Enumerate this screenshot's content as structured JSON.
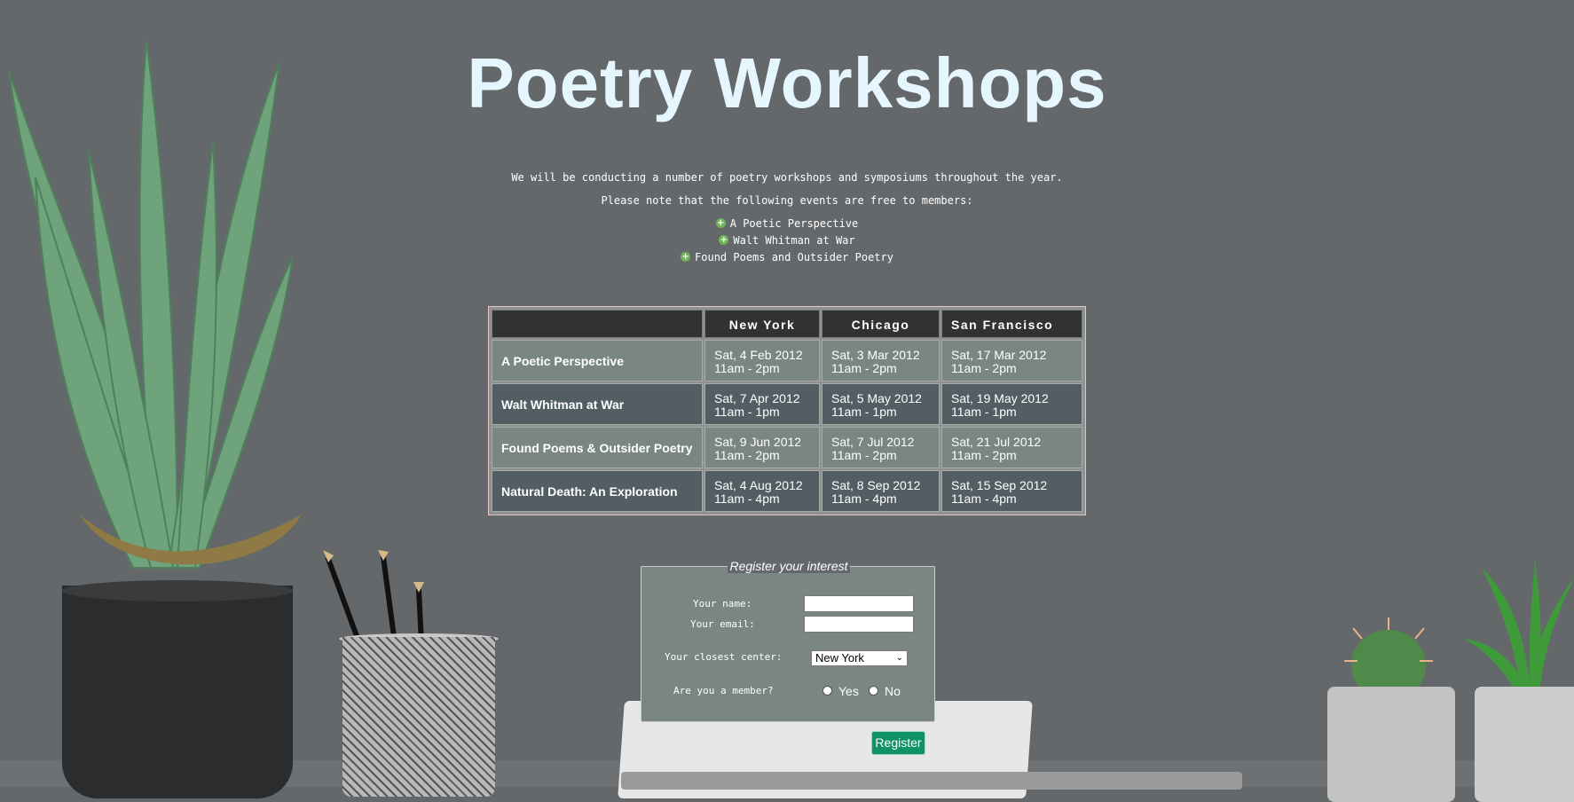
{
  "page": {
    "title": "Poetry Workshops",
    "intro_line1": "We will be conducting a number of poetry workshops and symposiums throughout the year.",
    "intro_line2": "Please note that the following events are free to members:",
    "free_events": [
      "A Poetic Perspective",
      "Walt Whitman at War",
      "Found Poems and Outsider Poetry"
    ]
  },
  "schedule": {
    "columns": [
      "",
      "New York",
      "Chicago",
      "San Francisco"
    ],
    "rows": [
      {
        "event": "A Poetic Perspective",
        "cells": [
          {
            "date": "Sat, 4 Feb 2012",
            "time": "11am - 2pm"
          },
          {
            "date": "Sat, 3 Mar 2012",
            "time": "11am - 2pm"
          },
          {
            "date": "Sat, 17 Mar 2012",
            "time": "11am - 2pm"
          }
        ]
      },
      {
        "event": "Walt Whitman at War",
        "cells": [
          {
            "date": "Sat, 7 Apr 2012",
            "time": "11am - 1pm"
          },
          {
            "date": "Sat, 5 May 2012",
            "time": "11am - 1pm"
          },
          {
            "date": "Sat, 19 May 2012",
            "time": "11am - 1pm"
          }
        ]
      },
      {
        "event": "Found Poems & Outsider Poetry",
        "cells": [
          {
            "date": "Sat, 9 Jun 2012",
            "time": "11am - 2pm"
          },
          {
            "date": "Sat, 7 Jul 2012",
            "time": "11am - 2pm"
          },
          {
            "date": "Sat, 21 Jul 2012",
            "time": "11am - 2pm"
          }
        ]
      },
      {
        "event": "Natural Death: An Exploration",
        "cells": [
          {
            "date": "Sat, 4 Aug 2012",
            "time": "11am - 4pm"
          },
          {
            "date": "Sat, 8 Sep 2012",
            "time": "11am - 4pm"
          },
          {
            "date": "Sat, 15 Sep 2012",
            "time": "11am - 4pm"
          }
        ]
      }
    ]
  },
  "form": {
    "legend": "Register your interest",
    "name_label": "Your name:",
    "name_value": "",
    "email_label": "Your email:",
    "email_value": "",
    "center_label": "Your closest center:",
    "center_selected": "New York",
    "member_label": "Are you a member?",
    "yes_label": "Yes",
    "no_label": "No",
    "submit_label": "Register"
  },
  "icons": {
    "bullet": "plus-circle-icon",
    "select_arrow": "chevron-down-icon"
  },
  "colors": {
    "background": "#65686b",
    "title": "#e6f6ff",
    "header_cell": "#303234",
    "row_light": "#7a8684",
    "row_dark": "#525e63",
    "bullet": "#6db556",
    "button": "#0f9264"
  }
}
